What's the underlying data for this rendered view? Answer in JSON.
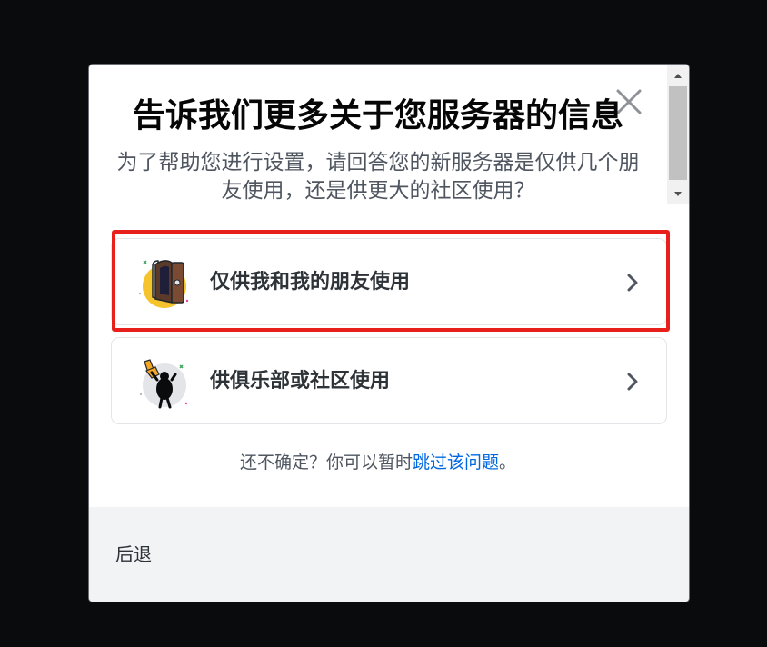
{
  "modal": {
    "title": "告诉我们更多关于您服务器的信息",
    "subtitle": "为了帮助您进行设置，请回答您的新服务器是仅供几个朋友使用，还是供更大的社区使用？",
    "close_icon": "close-icon"
  },
  "options": [
    {
      "label": "仅供我和我的朋友使用",
      "icon": "door-illustration-icon",
      "chevron": "chevron-right-icon"
    },
    {
      "label": "供俱乐部或社区使用",
      "icon": "foam-finger-illustration-icon",
      "chevron": "chevron-right-icon"
    }
  ],
  "skip": {
    "prefix": "还不确定？你可以暂时",
    "link": "跳过该问题",
    "suffix": "。"
  },
  "footer": {
    "back_label": "后退"
  },
  "colors": {
    "backdrop": "#0a0b0d",
    "modal_bg": "#ffffff",
    "footer_bg": "#f2f3f5",
    "link": "#0068e0",
    "highlight": "#e8201b",
    "title": "#060607",
    "muted_text": "#4f5660"
  }
}
